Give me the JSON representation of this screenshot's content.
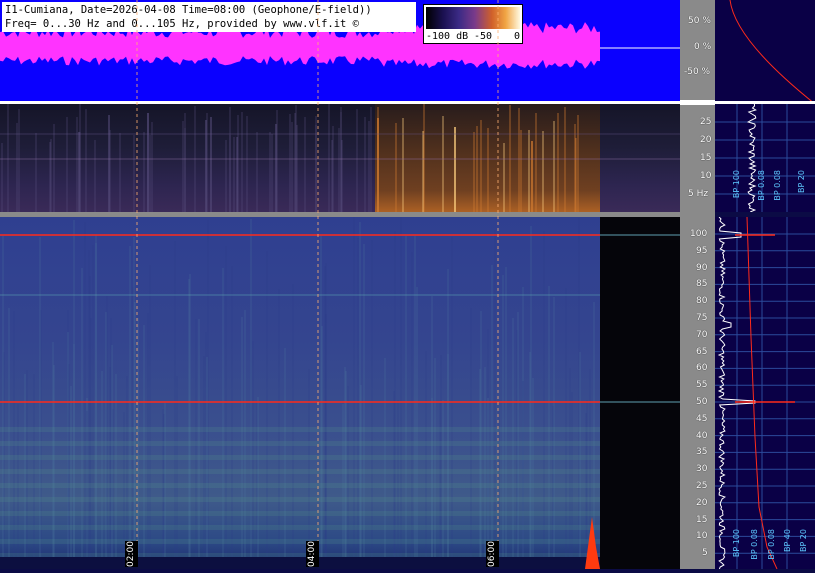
{
  "header": {
    "line1": "I1-Cumiana, Date=2026-04-08 Time=08:00 (Geophone/E-field))",
    "line2": "Freq= 0...30 Hz and 0...105 Hz, provided by www.vlf.it ©"
  },
  "colorbar": {
    "min_label": "-100 dB",
    "mid_label": "-50",
    "max_label": "0"
  },
  "wave_scale": [
    "50 %",
    "0 %",
    "-50 %"
  ],
  "top_scale": [
    "25",
    "20",
    "15",
    "10",
    "5 Hz"
  ],
  "main_scale": [
    "100",
    "95",
    "90",
    "85",
    "80",
    "75",
    "70",
    "65",
    "60",
    "55",
    "50",
    "45",
    "40",
    "35",
    "30",
    "25",
    "20",
    "15",
    "10",
    "5"
  ],
  "time_marks": [
    "02:00",
    "04:00",
    "06:00"
  ],
  "bp_labels_top": [
    "BP 100",
    "BP 0.08",
    "BP 0.08",
    "BP 20"
  ],
  "bp_labels_main": [
    "BP 100",
    "BP 0.08",
    "BP 0.08",
    "BP 40",
    "BP 20"
  ],
  "colors": {
    "wave_bg": "#0a00ff",
    "wave_signal": "#ff33ff",
    "side_gray": "#8a8a8a",
    "right_bg": "#0a0046",
    "mark_red": "#ff2a1a"
  }
}
